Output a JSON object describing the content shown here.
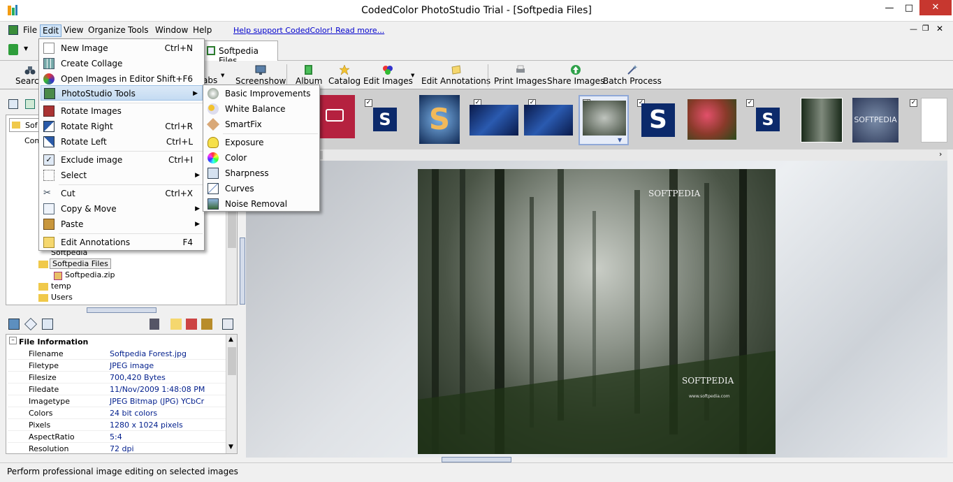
{
  "window": {
    "title": "CodedColor PhotoStudio Trial - [Softpedia Files]"
  },
  "menubar": {
    "items": [
      "File",
      "Edit",
      "View",
      "Organize",
      "Tools",
      "Window",
      "Help"
    ],
    "support_link": "Help support CodedColor! Read more..."
  },
  "tabs": {
    "doc_tab": "Softpedia Files"
  },
  "toolbar": {
    "search": "Search",
    "tabs_partial": "abs",
    "screenshow": "Screenshow",
    "album": "Album",
    "catalog": "Catalog",
    "edit_images": "Edit Images",
    "edit_annotations": "Edit Annotations",
    "print_images": "Print Images",
    "share_images": "Share Images",
    "batch_process": "Batch Process"
  },
  "edit_menu": {
    "items": [
      {
        "label": "New Image",
        "shortcut": "Ctrl+N"
      },
      {
        "label": "Create Collage",
        "shortcut": ""
      },
      {
        "label": "Open Images in Editor",
        "shortcut": "Shift+F6"
      },
      {
        "label": "PhotoStudio Tools",
        "shortcut": ""
      },
      {
        "label": "Rotate Images",
        "shortcut": ""
      },
      {
        "label": "Rotate Right",
        "shortcut": "Ctrl+R"
      },
      {
        "label": "Rotate Left",
        "shortcut": "Ctrl+L"
      },
      {
        "label": "Exclude image",
        "shortcut": "Ctrl+I"
      },
      {
        "label": "Select",
        "shortcut": ""
      },
      {
        "label": "Cut",
        "shortcut": "Ctrl+X"
      },
      {
        "label": "Copy & Move",
        "shortcut": ""
      },
      {
        "label": "Paste",
        "shortcut": ""
      },
      {
        "label": "Edit Annotations",
        "shortcut": "F4"
      }
    ]
  },
  "tools_submenu": {
    "items": [
      "Basic Improvements",
      "White Balance",
      "SmartFix",
      "Exposure",
      "Color",
      "Sharpness",
      "Curves",
      "Noise Removal"
    ]
  },
  "tree": {
    "partial_sof": "Sof",
    "partial_com": "Com",
    "items": [
      "Softpedia",
      "Softpedia Files",
      "Softpedia.zip",
      "temp",
      "Users"
    ]
  },
  "file_info": {
    "header": "File Information",
    "rows": [
      {
        "k": "Filename",
        "v": "Softpedia Forest.jpg"
      },
      {
        "k": "Filetype",
        "v": "JPEG image"
      },
      {
        "k": "Filesize",
        "v": "700,420 Bytes"
      },
      {
        "k": "Filedate",
        "v": "11/Nov/2009 1:48:08 PM"
      },
      {
        "k": "Imagetype",
        "v": "JPEG Bitmap (JPG) YCbCr"
      },
      {
        "k": "Colors",
        "v": "24 bit colors"
      },
      {
        "k": "Pixels",
        "v": "1280 x 1024 pixels"
      },
      {
        "k": "AspectRatio",
        "v": "5:4"
      },
      {
        "k": "Resolution",
        "v": "72 dpi"
      }
    ]
  },
  "photo": {
    "watermark_top": "SOFTPEDIA",
    "watermark_bottom": "SOFTPEDIA",
    "url": "www.softpedia.com"
  },
  "thumbs": {
    "s_letter": "S",
    "softpedia_round": "SOFTPEDIA"
  },
  "status": {
    "text": "Perform professional image editing on selected images"
  },
  "colors": {
    "accent": "#001e8c",
    "softpedia_blue": "#0c2a6b",
    "highlight": "#c4dbf2"
  }
}
